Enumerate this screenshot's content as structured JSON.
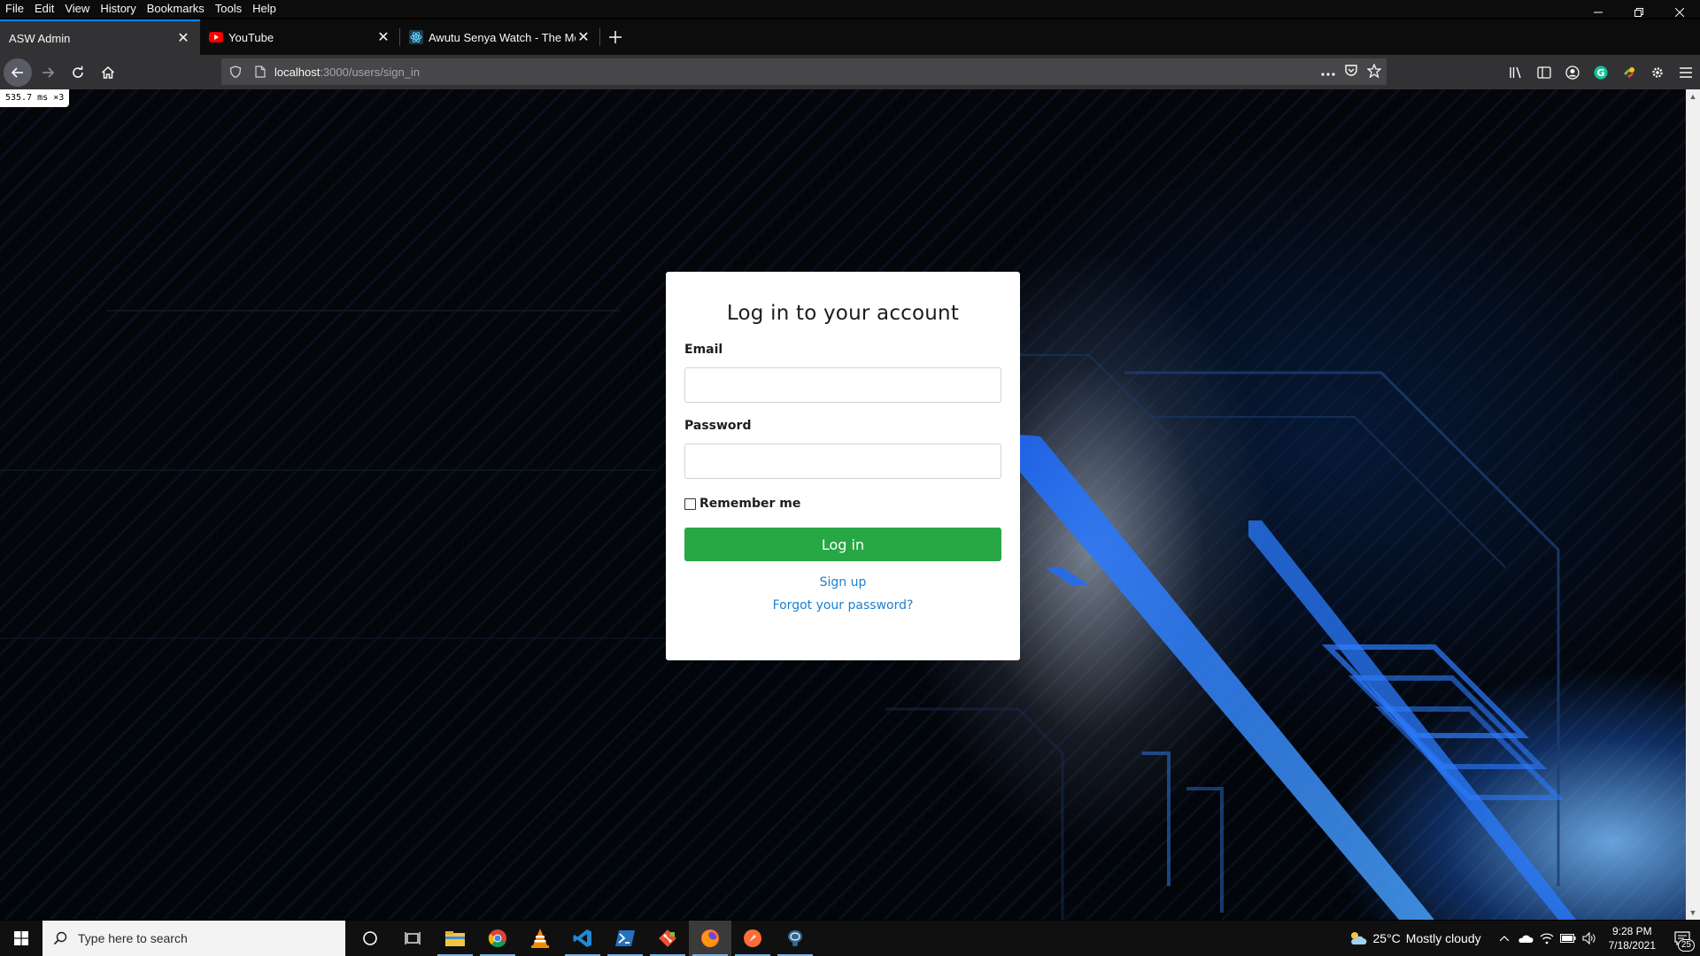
{
  "browser": {
    "menu": [
      "File",
      "Edit",
      "View",
      "History",
      "Bookmarks",
      "Tools",
      "Help"
    ],
    "tabs": [
      {
        "title": "ASW Admin",
        "active": true,
        "favicon": "none"
      },
      {
        "title": "YouTube",
        "active": false,
        "favicon": "youtube-icon"
      },
      {
        "title": "Awutu Senya Watch - The Mou",
        "active": false,
        "favicon": "react-icon"
      }
    ],
    "url": {
      "host": "localhost",
      "path": ":3000/users/sign_in"
    },
    "accent_color": "#0a84ff"
  },
  "perf_badge": {
    "value": "535.7",
    "unit": "ms",
    "multiplier": "×3"
  },
  "login": {
    "title": "Log in to your account",
    "email_label": "Email",
    "email_value": "",
    "password_label": "Password",
    "password_value": "",
    "remember_label": "Remember me",
    "remember_checked": false,
    "submit_label": "Log in",
    "signup_link": "Sign up",
    "forgot_link": "Forgot your password?",
    "button_color": "#28a745",
    "link_color": "#1e7fcf"
  },
  "taskbar": {
    "search_placeholder": "Type here to search",
    "apps": [
      "cortana-icon",
      "task-view-icon",
      "file-explorer-icon",
      "chrome-icon",
      "vlc-icon",
      "vscode-icon",
      "powershell-icon",
      "git-icon",
      "firefox-icon",
      "postman-icon",
      "postgres-icon"
    ],
    "weather": {
      "temp": "25°C",
      "condition": "Mostly cloudy"
    },
    "clock": {
      "time": "9:28 PM",
      "date": "7/18/2021"
    },
    "notifications": "25"
  }
}
